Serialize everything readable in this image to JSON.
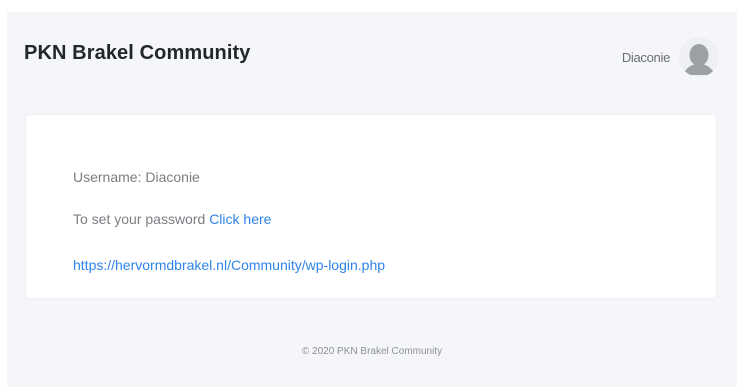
{
  "header": {
    "site_title": "PKN Brakel Community",
    "user_name": "Diaconie",
    "avatar_icon": "user-avatar-icon"
  },
  "card": {
    "username_label": "Username:",
    "username_value": "Diaconie",
    "password_text": "To set your password",
    "password_link": "Click here",
    "login_url": "https://hervormdbrakel.nl/Community/wp-login.php"
  },
  "footer": {
    "copyright": "© 2020 PKN Brakel Community"
  },
  "colors": {
    "background": "#f5f6f9",
    "card": "#ffffff",
    "link": "#2f84e8",
    "title": "#23262b"
  }
}
